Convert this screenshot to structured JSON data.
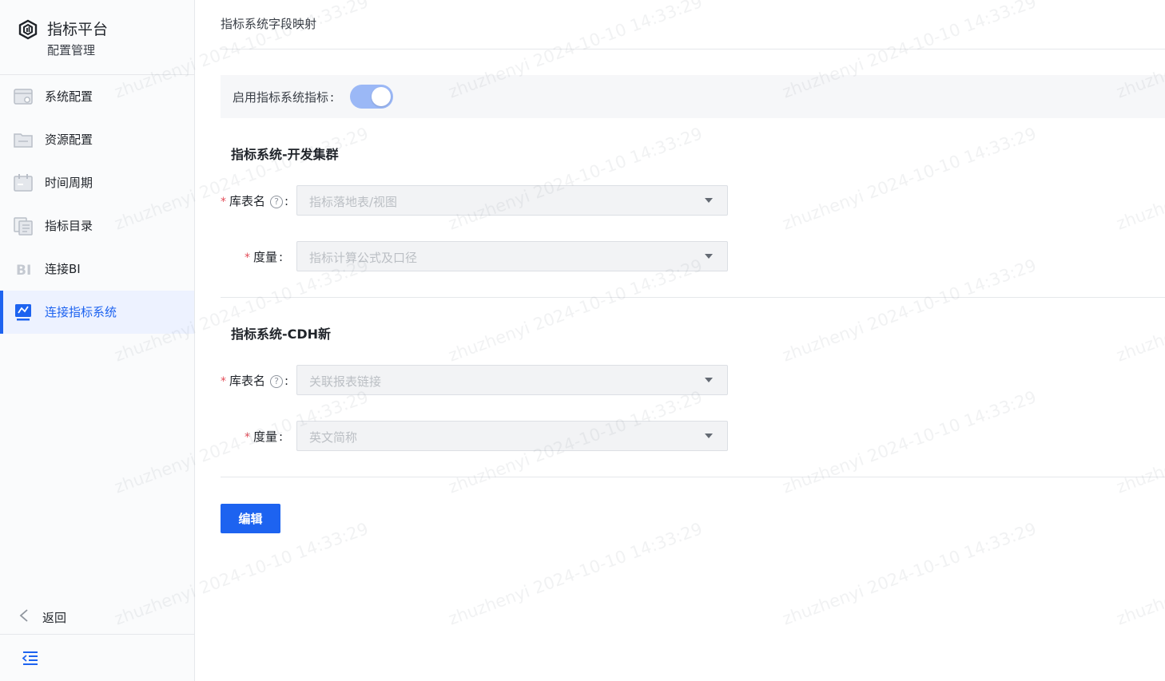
{
  "brand": {
    "title": "指标平台",
    "subtitle": "配置管理"
  },
  "sidebar": {
    "items": [
      {
        "label": "系统配置",
        "icon": "settings-window-icon"
      },
      {
        "label": "资源配置",
        "icon": "folder-icon"
      },
      {
        "label": "时间周期",
        "icon": "calendar-icon"
      },
      {
        "label": "指标目录",
        "icon": "catalog-icon"
      },
      {
        "label": "连接BI",
        "icon": "bi-icon"
      },
      {
        "label": "连接指标系统",
        "icon": "metric-system-icon",
        "active": true
      }
    ],
    "back_label": "返回"
  },
  "main": {
    "page_title": "指标系统字段映射",
    "enable": {
      "label": "启用指标系统指标",
      "on": true
    },
    "sections": [
      {
        "title": "指标系统-开发集群",
        "fields": [
          {
            "label": "库表名",
            "required": true,
            "help": true,
            "placeholder": "指标落地表/视图"
          },
          {
            "label": "度量",
            "required": true,
            "help": false,
            "placeholder": "指标计算公式及口径"
          }
        ]
      },
      {
        "title": "指标系统-CDH新",
        "fields": [
          {
            "label": "库表名",
            "required": true,
            "help": true,
            "placeholder": "关联报表链接"
          },
          {
            "label": "度量",
            "required": true,
            "help": false,
            "placeholder": "英文简称"
          }
        ]
      }
    ],
    "edit_button": "编辑"
  },
  "watermark": "zhuzhenyi 2024-10-10 14:33:29",
  "colors": {
    "primary": "#1d63f0",
    "toggle_on": "#9bb8f6",
    "required": "#e34d59",
    "sidebar_bg": "#fafbfc"
  }
}
